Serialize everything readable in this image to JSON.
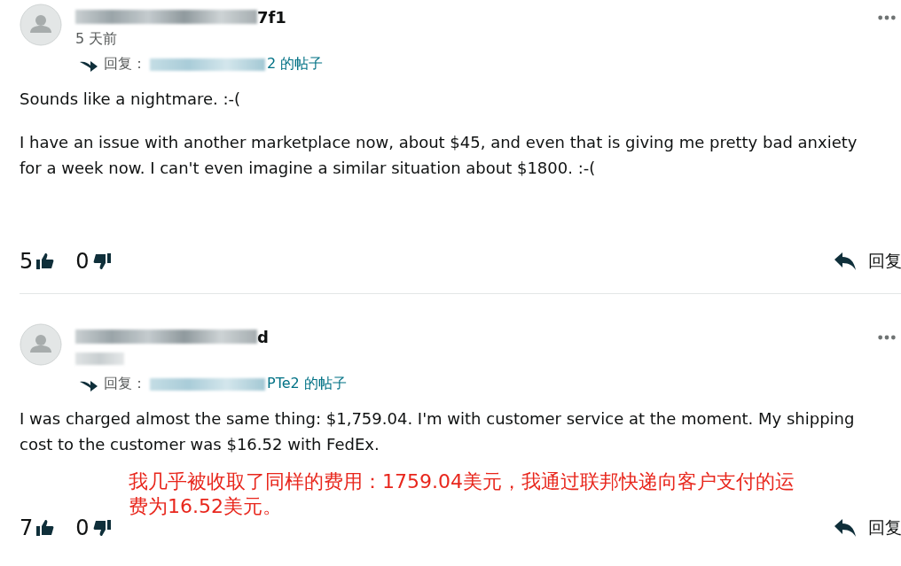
{
  "comments": [
    {
      "author": {
        "redacted": true,
        "visible": "7f1"
      },
      "time": {
        "redacted": false,
        "text": "5 天前"
      },
      "reply_to": {
        "label": "回复：",
        "redacted": true,
        "visible": "2 的帖子"
      },
      "paragraphs": [
        "Sounds like a nightmare. :-(",
        "I have an issue with another marketplace now, about $45, and even that is giving me pretty bad anxiety for a week now. I can't even imagine a similar situation about $1800. :-("
      ],
      "upvotes": "5",
      "downvotes": "0",
      "reply_label": "回复"
    },
    {
      "author": {
        "redacted": true,
        "visible": "d"
      },
      "time": {
        "redacted": true
      },
      "reply_to": {
        "label": "回复：",
        "redacted": true,
        "visible": "PTe2 的帖子"
      },
      "paragraphs": [
        "I was charged almost the same thing: $1,759.04. I'm with customer service at the moment. My shipping cost to the customer was $16.52 with FedEx."
      ],
      "upvotes": "7",
      "downvotes": "0",
      "reply_label": "回复",
      "translation_note": "我几乎被收取了同样的费用：1759.04美元，我通过联邦快递向客户支付的运费为16.52美元。"
    }
  ]
}
